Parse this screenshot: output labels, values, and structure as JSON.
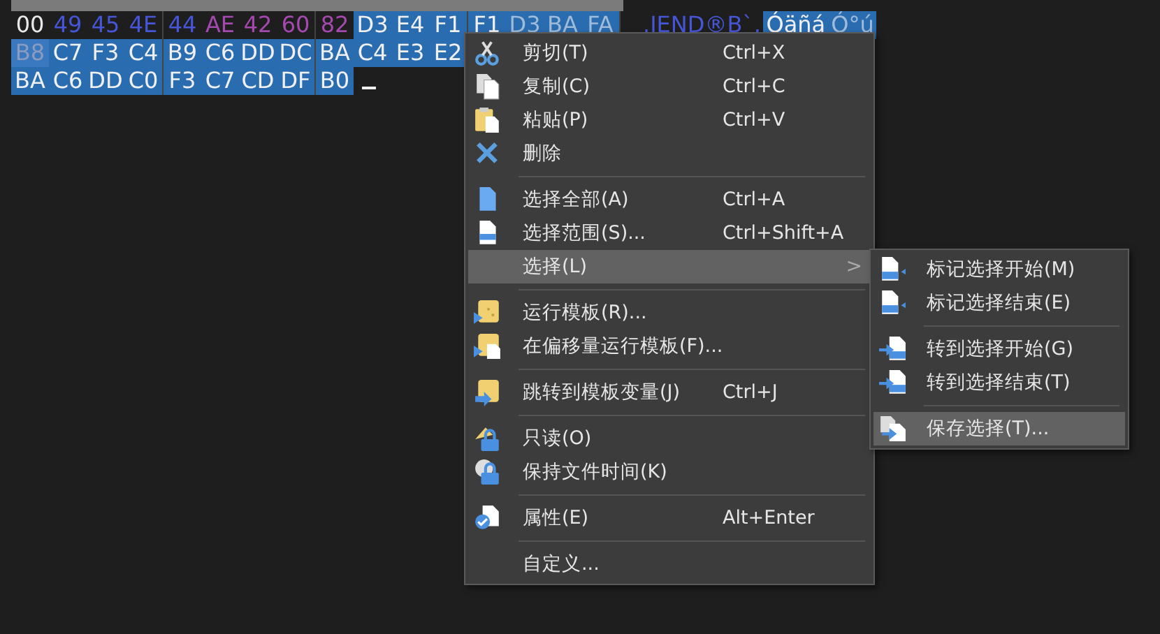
{
  "hex_view": {
    "rows": [
      {
        "bytes": [
          {
            "text": "00",
            "kind": "plain"
          },
          {
            "text": "49",
            "kind": "navy"
          },
          {
            "text": "45",
            "kind": "navy"
          },
          {
            "text": "4E",
            "kind": "navy"
          },
          {
            "text": "44",
            "kind": "navy"
          },
          {
            "text": "AE",
            "kind": "purple"
          },
          {
            "text": "42",
            "kind": "purple"
          },
          {
            "text": "60",
            "kind": "purple"
          },
          {
            "text": "82",
            "kind": "purple"
          },
          {
            "text": "D3",
            "kind": "selected"
          },
          {
            "text": "E4",
            "kind": "selected"
          },
          {
            "text": "F1",
            "kind": "selected"
          },
          {
            "text": "F1",
            "kind": "selected"
          },
          {
            "text": "D3",
            "kind": "selected-dim"
          },
          {
            "text": "BA",
            "kind": "selected-dim"
          },
          {
            "text": "FA",
            "kind": "selected-dim"
          }
        ],
        "ascii": [
          {
            "text": ".IEND®B`‚",
            "kind": "navy"
          },
          {
            "text": "Óäñá",
            "kind": "selected"
          },
          {
            "text": "Ó°ú",
            "kind": "selected-dim"
          }
        ]
      },
      {
        "bytes": [
          {
            "text": "B8",
            "kind": "cursor"
          },
          {
            "text": "C7",
            "kind": "selected"
          },
          {
            "text": "F3",
            "kind": "selected"
          },
          {
            "text": "C4",
            "kind": "selected"
          },
          {
            "text": "B9",
            "kind": "selected"
          },
          {
            "text": "C6",
            "kind": "selected"
          },
          {
            "text": "DD",
            "kind": "selected"
          },
          {
            "text": "DC",
            "kind": "selected"
          },
          {
            "text": "BA",
            "kind": "selected"
          },
          {
            "text": "C4",
            "kind": "selected"
          },
          {
            "text": "E3",
            "kind": "selected"
          },
          {
            "text": "E2",
            "kind": "selected"
          }
        ],
        "ascii": []
      },
      {
        "bytes": [
          {
            "text": "BA",
            "kind": "selected"
          },
          {
            "text": "C6",
            "kind": "selected"
          },
          {
            "text": "DD",
            "kind": "selected"
          },
          {
            "text": "C0",
            "kind": "selected"
          },
          {
            "text": "F3",
            "kind": "selected"
          },
          {
            "text": "C7",
            "kind": "selected"
          },
          {
            "text": "CD",
            "kind": "selected"
          },
          {
            "text": "DF",
            "kind": "selected"
          },
          {
            "text": "B0",
            "kind": "selected"
          }
        ],
        "ascii": []
      }
    ]
  },
  "context_menu": {
    "items": [
      {
        "kind": "item",
        "label": "剪切(T)",
        "shortcut": "Ctrl+X",
        "selected": false
      },
      {
        "kind": "item",
        "label": "复制(C)",
        "shortcut": "Ctrl+C",
        "selected": false
      },
      {
        "kind": "item",
        "label": "粘贴(P)",
        "shortcut": "Ctrl+V",
        "selected": false
      },
      {
        "kind": "item",
        "label": "删除",
        "selected": false
      },
      {
        "kind": "separator"
      },
      {
        "kind": "item",
        "label": "选择全部(A)",
        "shortcut": "Ctrl+A",
        "selected": false
      },
      {
        "kind": "item",
        "label": "选择范围(S)...",
        "shortcut": "Ctrl+Shift+A",
        "selected": false
      },
      {
        "kind": "submenu",
        "label": "选择(L)",
        "arrow": ">",
        "selected": true
      },
      {
        "kind": "separator"
      },
      {
        "kind": "item",
        "label": "运行模板(R)...",
        "selected": false
      },
      {
        "kind": "item",
        "label": "在偏移量运行模板(F)...",
        "selected": false
      },
      {
        "kind": "separator"
      },
      {
        "kind": "item",
        "label": "跳转到模板变量(J)",
        "shortcut": "Ctrl+J",
        "selected": false
      },
      {
        "kind": "separator"
      },
      {
        "kind": "item",
        "label": "只读(O)",
        "selected": false
      },
      {
        "kind": "item",
        "label": "保持文件时间(K)",
        "selected": false
      },
      {
        "kind": "separator"
      },
      {
        "kind": "item",
        "label": "属性(E)",
        "shortcut": "Alt+Enter",
        "selected": false
      },
      {
        "kind": "separator"
      },
      {
        "kind": "item",
        "label": "自定义...",
        "selected": false
      }
    ]
  },
  "submenu": {
    "items": [
      {
        "kind": "item",
        "label": "标记选择开始(M)",
        "selected": false
      },
      {
        "kind": "item",
        "label": "标记选择结束(E)",
        "selected": false
      },
      {
        "kind": "separator"
      },
      {
        "kind": "item",
        "label": "转到选择开始(G)",
        "selected": false
      },
      {
        "kind": "item",
        "label": "转到选择结束(T)",
        "selected": false
      },
      {
        "kind": "separator"
      },
      {
        "kind": "item",
        "label": "保存选择(T)...",
        "selected": true
      }
    ]
  }
}
